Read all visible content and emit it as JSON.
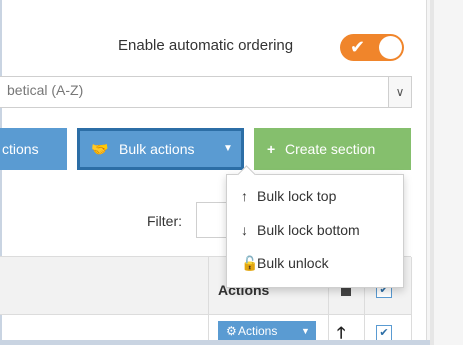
{
  "ordering": {
    "label": "Enable automatic ordering",
    "enabled": true,
    "check_glyph": "✔",
    "toggle_color": "#f0852b"
  },
  "sort": {
    "value_visible": "betical (A-Z)",
    "arrow_glyph": "∨"
  },
  "toolbar": {
    "actions_label": "ctions",
    "bulk_label": "Bulk actions",
    "bulk_icon": "users-icon",
    "bulk_icon_glyph": "🤝",
    "caret_glyph": "▼",
    "create_label": "Create section",
    "create_icon_glyph": "+",
    "colors": {
      "primary": "#5a9bd2",
      "primary_border": "#2c6ea6",
      "success": "#85bf6d"
    }
  },
  "bulk_menu": {
    "items": [
      {
        "label": "Bulk lock top",
        "icon": "arrow-up-icon",
        "glyph": "↑"
      },
      {
        "label": "Bulk lock bottom",
        "icon": "arrow-down-icon",
        "glyph": "↓"
      },
      {
        "label": "Bulk unlock",
        "icon": "unlock-icon",
        "glyph": "🔓"
      }
    ]
  },
  "filter": {
    "label": "Filter:",
    "value": ""
  },
  "table": {
    "header_actions": "Actions",
    "row": {
      "actions_label": "Actions",
      "gear_glyph": "⚙",
      "up_glyph": "🡑",
      "check_glyph": "✔"
    },
    "header_check_glyph": "✔"
  }
}
